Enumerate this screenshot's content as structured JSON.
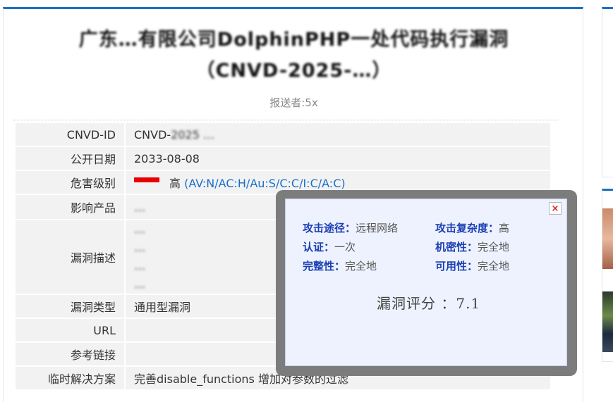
{
  "title": {
    "line1": "广东…有限公司DolphinPHP一处代码执行漏洞",
    "line2": "（CNVD-2025-…）"
  },
  "reporter": "报送者:5x",
  "rows": {
    "cnvd_id": {
      "label": "CNVD-ID",
      "value": "CNVD-",
      "value_blurred": "2025 …"
    },
    "publish_date": {
      "label": "公开日期",
      "value": "2033-08-08"
    },
    "severity": {
      "label": "危害级别",
      "level": "高",
      "cvss": "(AV:N/AC:H/Au:S/C:C/I:C/A:C)"
    },
    "affected": {
      "label": "影响产品",
      "value": "…"
    },
    "description": {
      "label": "漏洞描述",
      "lines": [
        "…",
        "…",
        "…",
        "…"
      ]
    },
    "vuln_type": {
      "label": "漏洞类型",
      "value": "通用型漏洞"
    },
    "url": {
      "label": "URL",
      "value": ""
    },
    "reference": {
      "label": "参考链接",
      "value": ""
    },
    "workaround": {
      "label": "临时解决方案",
      "value": "完善disable_functions 增加对参数的过滤"
    }
  },
  "popup": {
    "close": "×",
    "metrics": [
      {
        "key": "攻击途径：",
        "value": "远程网络"
      },
      {
        "key": "攻击复杂度：",
        "value": "高"
      },
      {
        "key": "认证：",
        "value": "一次"
      },
      {
        "key": "机密性：",
        "value": "完全地"
      },
      {
        "key": "完整性：",
        "value": "完全地"
      },
      {
        "key": "可用性：",
        "value": "完全地"
      }
    ],
    "score_label": "漏洞评分 ：7.1"
  },
  "colors": {
    "accent": "#1c6fbf",
    "severity_bar": "#e60000",
    "link": "#1a6fc6"
  }
}
